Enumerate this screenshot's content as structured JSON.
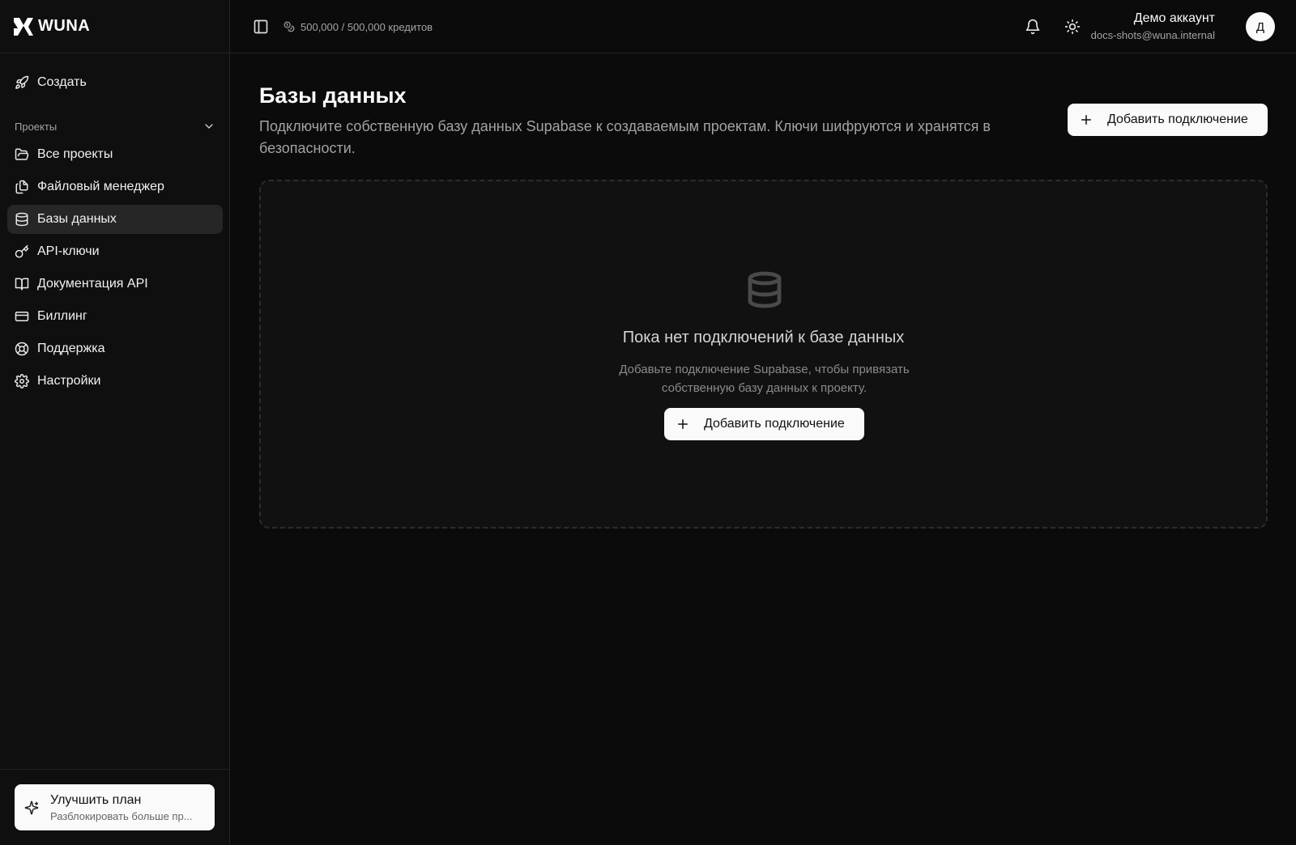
{
  "app": {
    "name": "WUNA"
  },
  "sidebar": {
    "create_label": "Создать",
    "group_label": "Проекты",
    "items": [
      {
        "label": "Все проекты",
        "icon": "folder-open-icon"
      },
      {
        "label": "Файловый менеджер",
        "icon": "files-icon"
      },
      {
        "label": "Базы данных",
        "icon": "database-icon",
        "active": true
      },
      {
        "label": "API-ключи",
        "icon": "key-icon"
      },
      {
        "label": "Документация API",
        "icon": "book-open-icon"
      },
      {
        "label": "Биллинг",
        "icon": "credit-card-icon"
      },
      {
        "label": "Поддержка",
        "icon": "life-buoy-icon"
      },
      {
        "label": "Настройки",
        "icon": "settings-icon"
      }
    ],
    "upgrade": {
      "title": "Улучшить план",
      "subtitle": "Разблокировать больше пр..."
    }
  },
  "header": {
    "credits": "500,000 / 500,000 кредитов",
    "account_name": "Демо аккаунт",
    "account_email": "docs-shots@wuna.internal",
    "avatar_initial": "Д"
  },
  "main": {
    "title": "Базы данных",
    "description": "Подключите собственную базу данных Supabase к создаваемым проектам. Ключи шифруются и хранятся в безопасности.",
    "add_button": "Добавить подключение",
    "empty": {
      "title": "Пока нет подключений к базе данных",
      "description": "Добавьте подключение Supabase, чтобы привязать собственную базу данных к проекту.",
      "button": "Добавить подключение"
    }
  },
  "colors": {
    "background": "#0b0b0b",
    "sidebar": "#0f0f0f",
    "active_item": "#262626",
    "button_light": "#fafafa",
    "muted_text": "#a3a3a3"
  }
}
